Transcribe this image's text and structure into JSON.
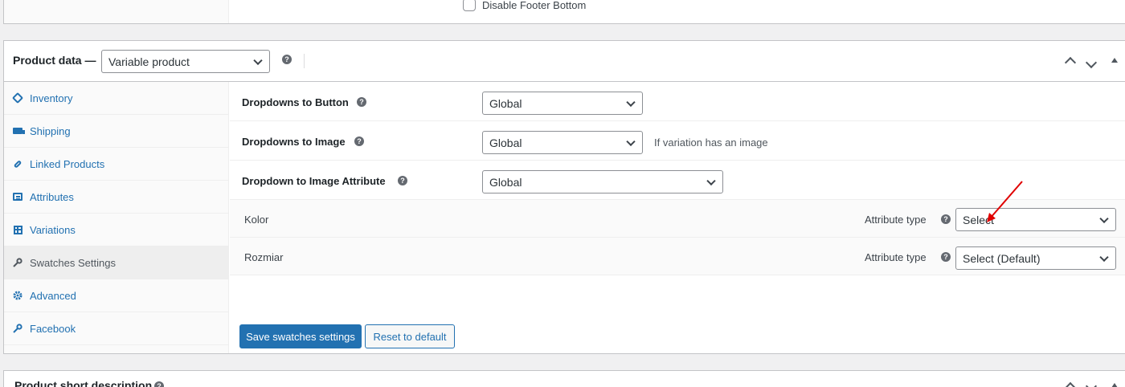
{
  "top_box": {
    "checkbox_label": "Disable Footer Bottom"
  },
  "product_data": {
    "title": "Product data —",
    "product_type": "Variable product",
    "help_glyph": "?"
  },
  "tabs": [
    {
      "label": "Inventory",
      "icon": "tag-icon"
    },
    {
      "label": "Shipping",
      "icon": "truck-icon"
    },
    {
      "label": "Linked Products",
      "icon": "link-icon"
    },
    {
      "label": "Attributes",
      "icon": "list-icon"
    },
    {
      "label": "Variations",
      "icon": "grid-icon"
    },
    {
      "label": "Swatches Settings",
      "icon": "wrench-icon",
      "active": true
    },
    {
      "label": "Advanced",
      "icon": "gear-icon"
    },
    {
      "label": "Facebook",
      "icon": "wrench-icon"
    }
  ],
  "swatches": {
    "dropdowns_to_button": {
      "label": "Dropdowns to Button",
      "value": "Global"
    },
    "dropdowns_to_image": {
      "label": "Dropdowns to Image",
      "value": "Global",
      "note": "If variation has an image"
    },
    "dropdown_to_image_attribute": {
      "label": "Dropdown to Image Attribute",
      "value": "Global"
    },
    "attributes": [
      {
        "name": "Kolor",
        "type_label": "Attribute type",
        "value": "Select"
      },
      {
        "name": "Rozmiar",
        "type_label": "Attribute type",
        "value": "Select (Default)"
      }
    ],
    "save_label": "Save swatches settings",
    "reset_label": "Reset to default"
  },
  "bottom_box": {
    "title": "Product short description"
  },
  "colors": {
    "accent": "#2271b1",
    "annotation_arrow": "#e00000"
  }
}
